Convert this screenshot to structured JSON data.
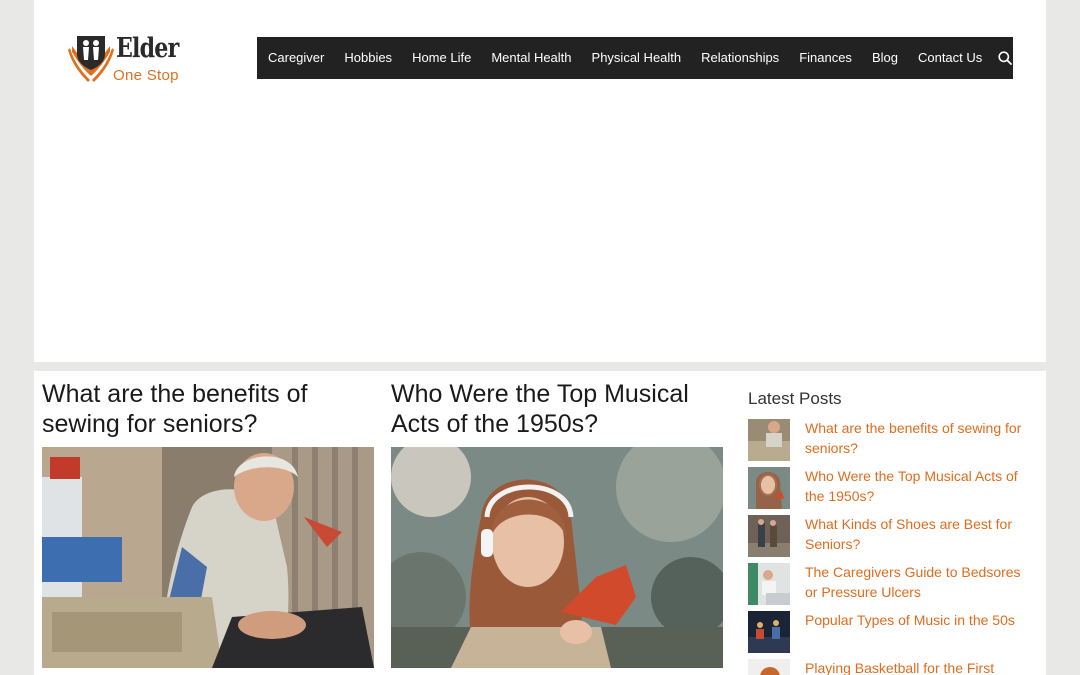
{
  "site": {
    "logo_word": "Elder",
    "logo_sub": "One Stop"
  },
  "nav": {
    "items": [
      "Caregiver",
      "Hobbies",
      "Home Life",
      "Mental Health",
      "Physical Health",
      "Relationships",
      "Finances",
      "Blog",
      "Contact Us"
    ],
    "search_icon": "search-icon"
  },
  "posts": [
    {
      "title": "What are the benefits of sewing for seniors?"
    },
    {
      "title": "Who Were the Top Musical Acts of the 1950s?"
    }
  ],
  "sidebar": {
    "title": "Latest Posts",
    "items": [
      "What are the benefits of sewing for seniors?",
      "Who Were the Top Musical Acts of the 1950s?",
      "What Kinds of Shoes are Best for Seniors?",
      "The Caregivers Guide to Bedsores or Pressure Ulcers",
      "Popular Types of Music in the 50s",
      "Playing Basketball for the First"
    ]
  },
  "colors": {
    "accent": "#e06c1e",
    "nav_bg": "#222222",
    "page_bg": "#e8e8e6"
  }
}
